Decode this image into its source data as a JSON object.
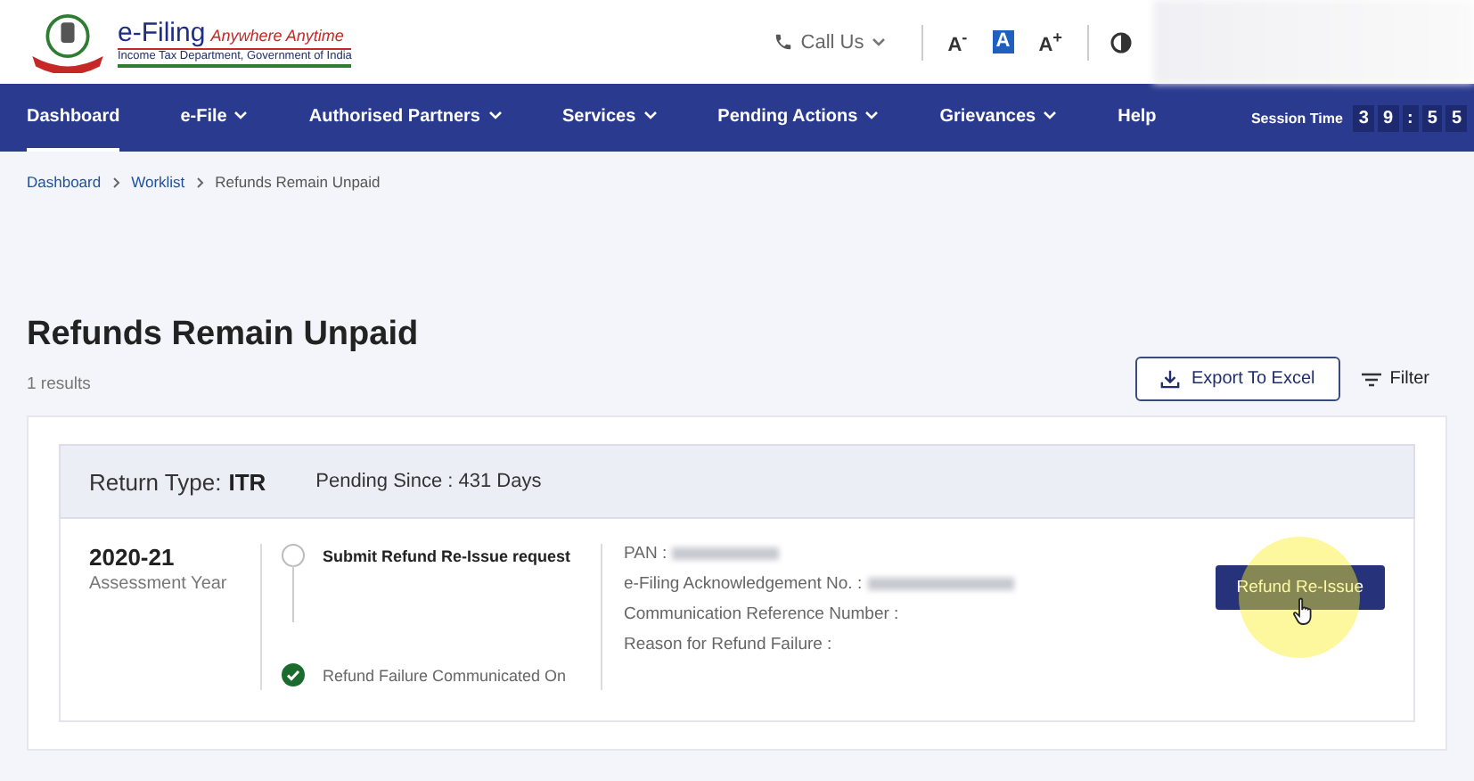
{
  "header": {
    "brand": "e-Filing",
    "tagline": "Anywhere Anytime",
    "department": "Income Tax Department, Government of India",
    "call_us": "Call Us",
    "font_controls": [
      {
        "label": "A$^{-}$",
        "selected": false
      },
      {
        "label": "A",
        "selected": true
      },
      {
        "label": "A$^{+}$",
        "selected": false
      }
    ]
  },
  "nav": {
    "items": [
      {
        "label": "Dashboard",
        "selected": true,
        "dropdown": false
      },
      {
        "label": "e-File",
        "selected": false,
        "dropdown": true
      },
      {
        "label": "Authorised Partners",
        "selected": false,
        "dropdown": true
      },
      {
        "label": "Services",
        "selected": false,
        "dropdown": true
      },
      {
        "label": "Pending Actions",
        "selected": false,
        "dropdown": true
      },
      {
        "label": "Grievances",
        "selected": false,
        "dropdown": true
      },
      {
        "label": "Help",
        "selected": false,
        "dropdown": false
      }
    ],
    "session_label": "Session Time",
    "session_time": [
      "3",
      "9",
      ":",
      "5",
      "5"
    ]
  },
  "breadcrumb": [
    "Dashboard",
    "Worklist",
    "Refunds Remain Unpaid"
  ],
  "page": {
    "title": "Refunds Remain Unpaid",
    "results": "1 results",
    "export_button": "Export To Excel",
    "filter_button": "Filter"
  },
  "card": {
    "return_type_label": "Return Type:",
    "return_type": "ITR",
    "pending_since": "Pending Since : 431 Days",
    "year": "2020-21",
    "year_label": "Assessment Year",
    "steps": [
      {
        "label": "Submit Refund Re-Issue request",
        "done": false
      },
      {
        "label": "Refund Failure Communicated On",
        "done": true
      }
    ],
    "fields": [
      {
        "label": "PAN :",
        "redacted": true
      },
      {
        "label": "e-Filing Acknowledgement No. :",
        "redacted": true
      },
      {
        "label": "Communication Reference Number :",
        "redacted": false
      },
      {
        "label": "Reason for Refund Failure :",
        "redacted": false
      }
    ],
    "action_button": "Refund Re-Issue"
  }
}
